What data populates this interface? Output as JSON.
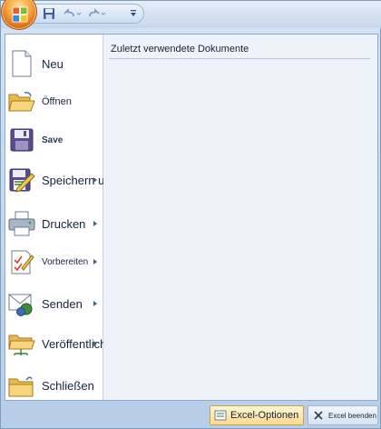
{
  "qat": {
    "office_button_icon": "office-logo-icon",
    "save_icon": "save-icon",
    "undo_icon": "undo-icon",
    "redo_icon": "redo-icon",
    "customize_icon": "customize-qat-icon"
  },
  "menu": {
    "items": [
      {
        "label": "Neu",
        "icon": "new-document-icon",
        "has_submenu": false
      },
      {
        "label": "Öffnen",
        "icon": "open-folder-icon",
        "has_submenu": false
      },
      {
        "label": "Save",
        "icon": "save-icon",
        "has_submenu": false
      },
      {
        "label": "Speichern unter",
        "icon": "save-as-icon",
        "has_submenu": true
      },
      {
        "label": "Drucken",
        "icon": "printer-icon",
        "has_submenu": true
      },
      {
        "label": "Vorbereiten",
        "icon": "prepare-icon",
        "has_submenu": true
      },
      {
        "label": "Senden",
        "icon": "send-icon",
        "has_submenu": true
      },
      {
        "label": "Veröffentlichen",
        "icon": "publish-icon",
        "has_submenu": true
      },
      {
        "label": "Schließen",
        "icon": "close-folder-icon",
        "has_submenu": false
      }
    ]
  },
  "recent": {
    "title": "Zuletzt verwendete Dokumente"
  },
  "footer": {
    "options_label": "Excel-Optionen",
    "exit_label": "Excel beenden"
  },
  "colors": {
    "accent": "#f5a13a",
    "frame": "#bfd3ea",
    "pane": "#eef3fa",
    "options_button": "#ffd98a"
  }
}
